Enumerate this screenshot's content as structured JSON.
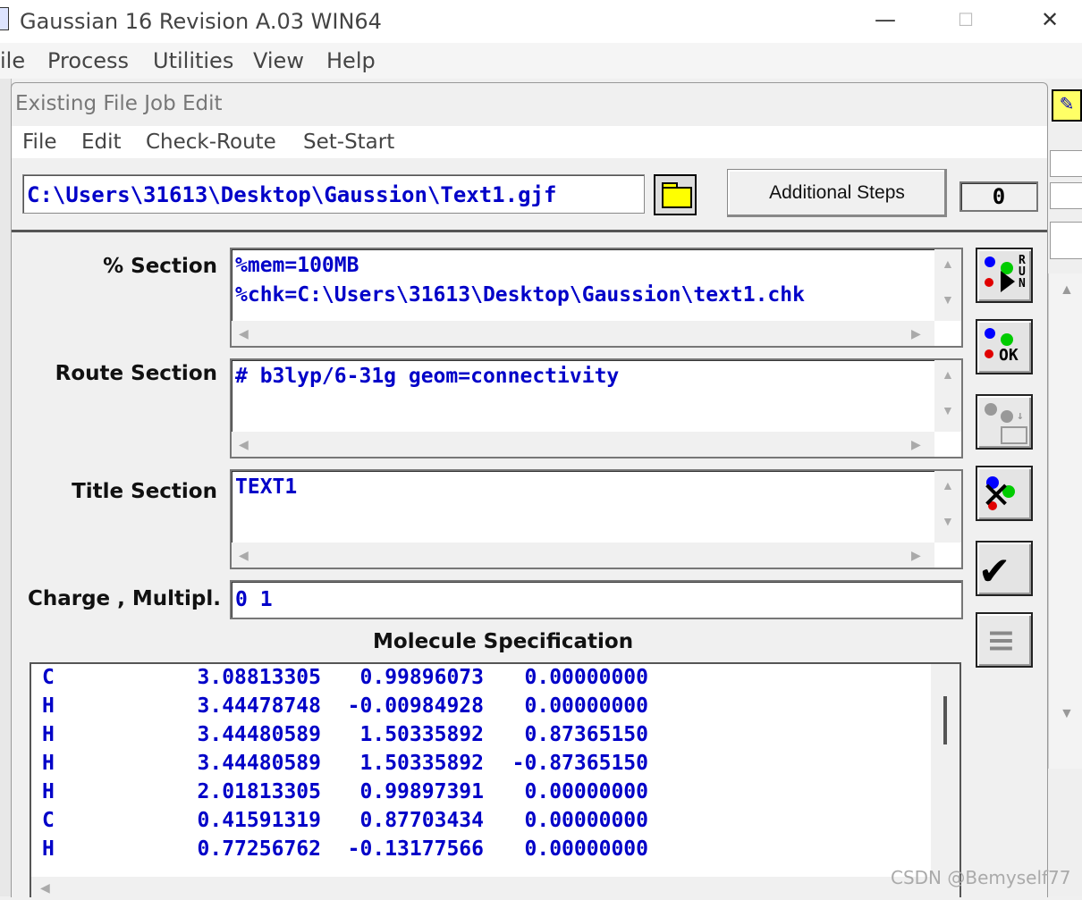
{
  "main_window": {
    "title": "Gaussian 16 Revision A.03 WIN64",
    "controls": {
      "minimize": "—",
      "maximize": "☐",
      "close": "✕"
    },
    "menu": [
      "ile",
      "Process",
      "Utilities",
      "View",
      "Help"
    ]
  },
  "dialog": {
    "title": "Existing File Job Edit",
    "menu": [
      "File",
      "Edit",
      "Check-Route",
      "Set-Start"
    ],
    "file_path": "C:\\Users\\31613\\Desktop\\Gaussion\\Text1.gjf",
    "additional_steps_label": "Additional Steps",
    "steps_count": "0",
    "sections": {
      "percent": {
        "label": "% Section",
        "lines": [
          "%mem=100MB",
          "%chk=C:\\Users\\31613\\Desktop\\Gaussion\\text1.chk"
        ]
      },
      "route": {
        "label": "Route Section",
        "lines": [
          "# b3lyp/6-31g geom=connectivity"
        ]
      },
      "title": {
        "label": "Title Section",
        "lines": [
          "TEXT1"
        ]
      }
    },
    "charge": {
      "label": "Charge , Multipl.",
      "value": "0 1"
    },
    "molecule": {
      "label": "Molecule Specification",
      "atoms": [
        {
          "el": "C",
          "x": "3.08813305",
          "y": "0.99896073",
          "z": "0.00000000"
        },
        {
          "el": "H",
          "x": "3.44478748",
          "y": "-0.00984928",
          "z": "0.00000000"
        },
        {
          "el": "H",
          "x": "3.44480589",
          "y": "1.50335892",
          "z": "0.87365150"
        },
        {
          "el": "H",
          "x": "3.44480589",
          "y": "1.50335892",
          "z": "-0.87365150"
        },
        {
          "el": "H",
          "x": "2.01813305",
          "y": "0.99897391",
          "z": "0.00000000"
        },
        {
          "el": "C",
          "x": "0.41591319",
          "y": "0.87703434",
          "z": "0.00000000"
        },
        {
          "el": "H",
          "x": "0.77256762",
          "y": "-0.13177566",
          "z": "0.00000000"
        }
      ]
    },
    "toolbar": {
      "run": {
        "icon": "run-icon",
        "text": "RUN"
      },
      "ok": {
        "icon": "ok-icon",
        "text": "OK"
      },
      "save": {
        "icon": "save-to-folder-icon",
        "text": "↓"
      },
      "cancel": {
        "icon": "cancel-x-icon",
        "text": "✕"
      },
      "check": {
        "icon": "check-icon",
        "text": "✔"
      },
      "list": {
        "icon": "list-icon",
        "text": "≡"
      }
    }
  },
  "watermark": "CSDN @Bemyself77",
  "colors": {
    "text_blue": "#0000c8",
    "folder_yellow": "#ffff00"
  }
}
